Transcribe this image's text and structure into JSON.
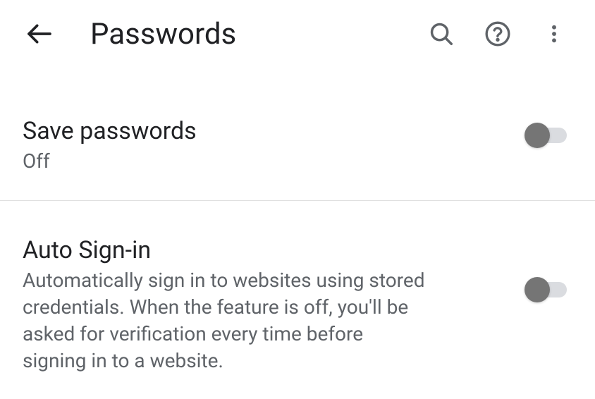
{
  "header": {
    "title": "Passwords"
  },
  "settings": {
    "savePasswords": {
      "title": "Save passwords",
      "subtitle": "Off",
      "enabled": false
    },
    "autoSignIn": {
      "title": "Auto Sign-in",
      "description": "Automatically sign in to websites using stored credentials. When the feature is off, you'll be asked for verification every time before signing in to a website.",
      "enabled": false
    }
  }
}
